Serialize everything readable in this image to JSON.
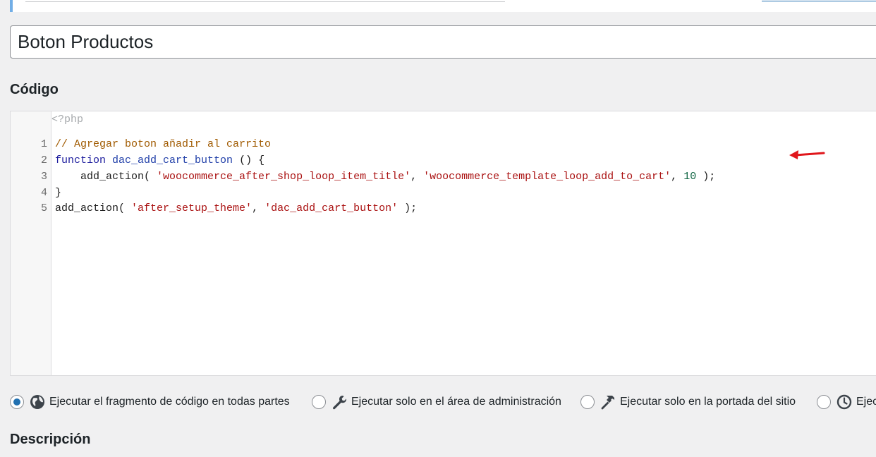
{
  "snippet_title": "Boton Productos",
  "code_heading": "Código",
  "description_heading": "Descripción",
  "php_open_tag": "<?php",
  "code_lines": [
    {
      "num": "1",
      "parts": [
        {
          "t": "// Agregar boton añadir al carrito",
          "c": "comment"
        }
      ]
    },
    {
      "num": "2",
      "parts": [
        {
          "t": "function",
          "c": "keyword"
        },
        {
          "t": " ",
          "c": ""
        },
        {
          "t": "dac_add_cart_button",
          "c": "def"
        },
        {
          "t": " () {",
          "c": ""
        }
      ]
    },
    {
      "num": "3",
      "parts": [
        {
          "t": "    add_action( ",
          "c": ""
        },
        {
          "t": "'woocommerce_after_shop_loop_item_title'",
          "c": "string"
        },
        {
          "t": ", ",
          "c": ""
        },
        {
          "t": "'woocommerce_template_loop_add_to_cart'",
          "c": "string"
        },
        {
          "t": ", ",
          "c": ""
        },
        {
          "t": "10",
          "c": "number"
        },
        {
          "t": " );",
          "c": ""
        }
      ]
    },
    {
      "num": "4",
      "parts": [
        {
          "t": "}",
          "c": ""
        }
      ]
    },
    {
      "num": "5",
      "parts": [
        {
          "t": "add_action( ",
          "c": ""
        },
        {
          "t": "'after_setup_theme'",
          "c": "string"
        },
        {
          "t": ", ",
          "c": ""
        },
        {
          "t": "'dac_add_cart_button'",
          "c": "string"
        },
        {
          "t": " );",
          "c": ""
        }
      ]
    }
  ],
  "scope_options": [
    {
      "label": "Ejecutar el fragmento de código en todas partes",
      "icon": "globe-icon",
      "checked": true
    },
    {
      "label": "Ejecutar solo en el área de administración",
      "icon": "wrench-icon",
      "checked": false
    },
    {
      "label": "Ejecutar solo en la portada del sitio",
      "icon": "hammer-icon",
      "checked": false
    },
    {
      "label": "Ejec",
      "icon": "clock-icon",
      "checked": false
    }
  ],
  "colors": {
    "accent": "#2271b1",
    "arrow": "#e0161b",
    "notice_border": "#72aee6"
  }
}
